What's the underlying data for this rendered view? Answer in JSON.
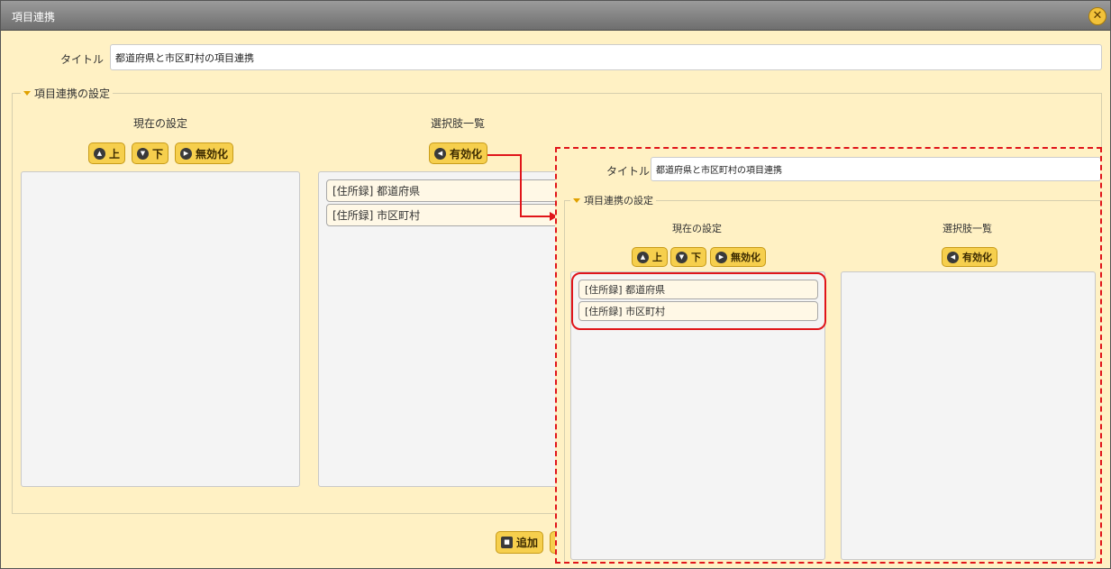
{
  "window": {
    "title": "項目連携"
  },
  "title_field": {
    "label": "タイトル",
    "value": "都道府県と市区町村の項目連携"
  },
  "settings": {
    "legend": "項目連携の設定",
    "current": {
      "heading": "現在の設定",
      "up_label": "上",
      "down_label": "下",
      "disable_label": "無効化",
      "items": []
    },
    "options": {
      "heading": "選択肢一覧",
      "enable_label": "有効化",
      "items": [
        "[住所録] 都道府県",
        "[住所録] 市区町村"
      ]
    }
  },
  "footer": {
    "add_label": "追加"
  },
  "result": {
    "title_label": "タイトル",
    "title_value": "都道府県と市区町村の項目連携",
    "legend": "項目連携の設定",
    "current": {
      "heading": "現在の設定",
      "up_label": "上",
      "down_label": "下",
      "disable_label": "無効化",
      "items": [
        "[住所録] 都道府県",
        "[住所録] 市区町村"
      ]
    },
    "options": {
      "heading": "選択肢一覧",
      "enable_label": "有効化",
      "items": []
    }
  },
  "colors": {
    "accent": "#f6cf4d",
    "annotation": "#e0151a",
    "background": "#fff1c4"
  }
}
